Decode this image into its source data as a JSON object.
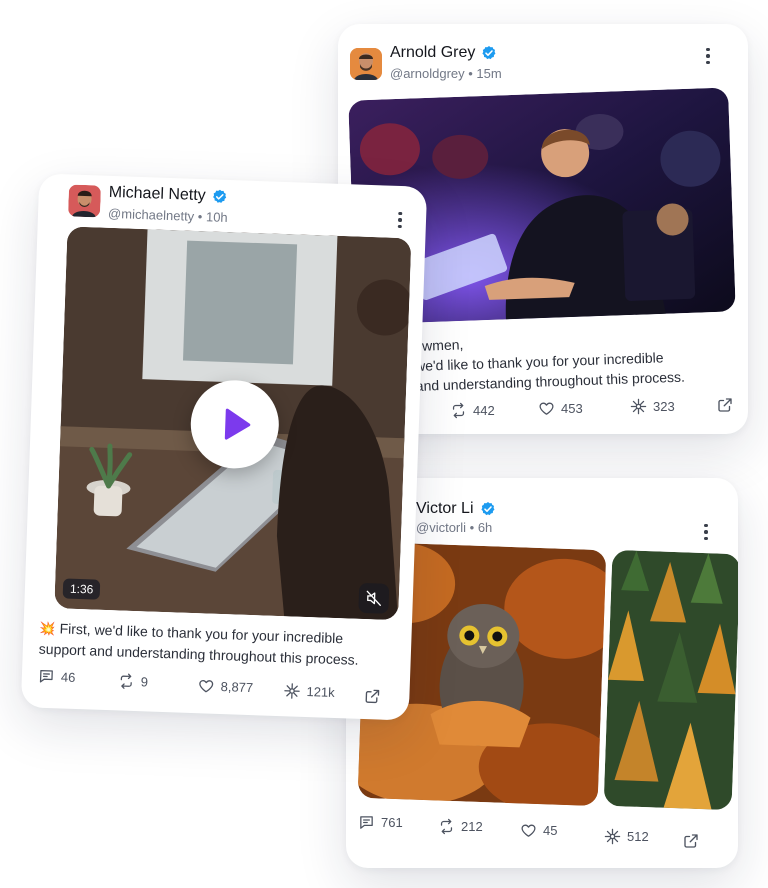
{
  "posts": [
    {
      "name": "Arnold Grey",
      "handle": "@arnoldgrey",
      "time": "15m",
      "text": "owmen,\nwe'd like to thank you for your incredible\nand understanding throughout this process.",
      "stats": {
        "reposts": "442",
        "likes": "453",
        "sparks": "323"
      }
    },
    {
      "name": "Victor Li",
      "handle": "@victorli",
      "time": "6h",
      "stats": {
        "comments": "761",
        "reposts": "212",
        "likes": "45",
        "sparks": "512"
      }
    },
    {
      "name": "Michael Netty",
      "handle": "@michaelnetty",
      "time": "10h",
      "emoji": "💥",
      "text": "First, we'd like to thank you for your incredible support and understanding throughout this process.",
      "video_duration": "1:36",
      "stats": {
        "comments": "46",
        "reposts": "9",
        "likes": "8,877",
        "sparks": "121k"
      }
    }
  ],
  "icons": [
    "verified-icon",
    "more-dots-icon",
    "comment-icon",
    "repost-icon",
    "heart-icon",
    "spark-icon",
    "share-icon",
    "play-icon",
    "mute-icon"
  ],
  "colors": {
    "verified": "#1d9bf0",
    "play": "#7c3aed"
  }
}
